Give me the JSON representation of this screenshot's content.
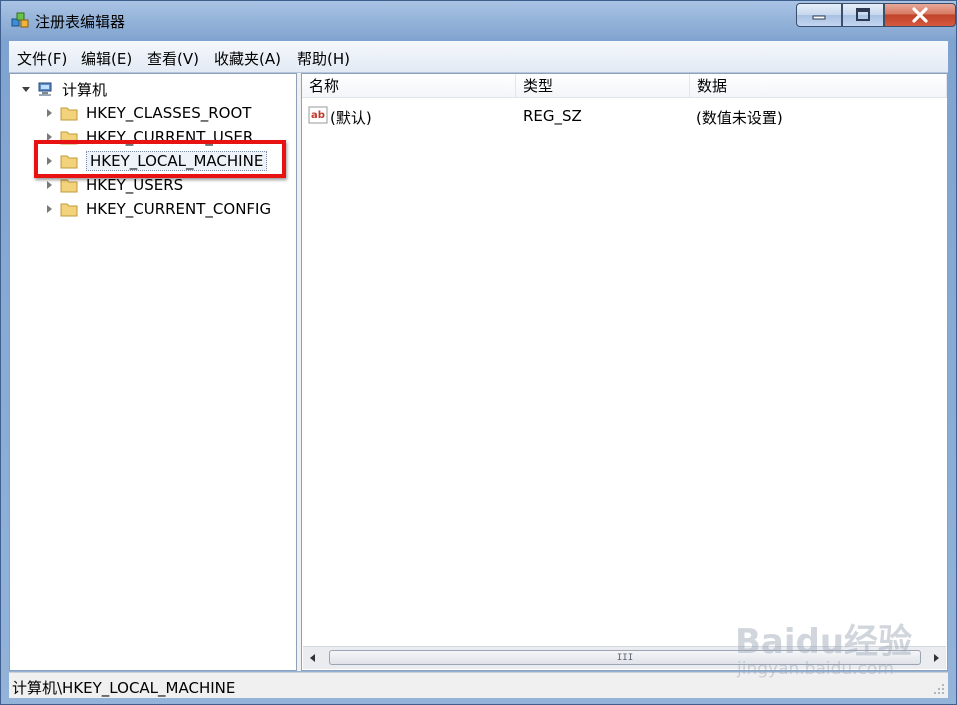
{
  "window": {
    "title": "注册表编辑器",
    "colors": {
      "highlight": "#e81212",
      "titlebar": "#93b3d9"
    }
  },
  "menu": [
    "文件(F)",
    "编辑(E)",
    "查看(V)",
    "收藏夹(A)",
    "帮助(H)"
  ],
  "tree": {
    "root": "计算机",
    "items": [
      "HKEY_CLASSES_ROOT",
      "HKEY_CURRENT_USER",
      "HKEY_LOCAL_MACHINE",
      "HKEY_USERS",
      "HKEY_CURRENT_CONFIG"
    ],
    "selected": "HKEY_LOCAL_MACHINE"
  },
  "list": {
    "columns": [
      "名称",
      "类型",
      "数据"
    ],
    "rows": [
      {
        "name": "(默认)",
        "type": "REG_SZ",
        "data": "(数值未设置)",
        "icon": "string-value-icon"
      }
    ],
    "scroll_grip": "III"
  },
  "statusbar": {
    "path": "计算机\\HKEY_LOCAL_MACHINE"
  },
  "watermark": {
    "logo": "Baidu经验",
    "url": "jingyan.baidu.com"
  }
}
